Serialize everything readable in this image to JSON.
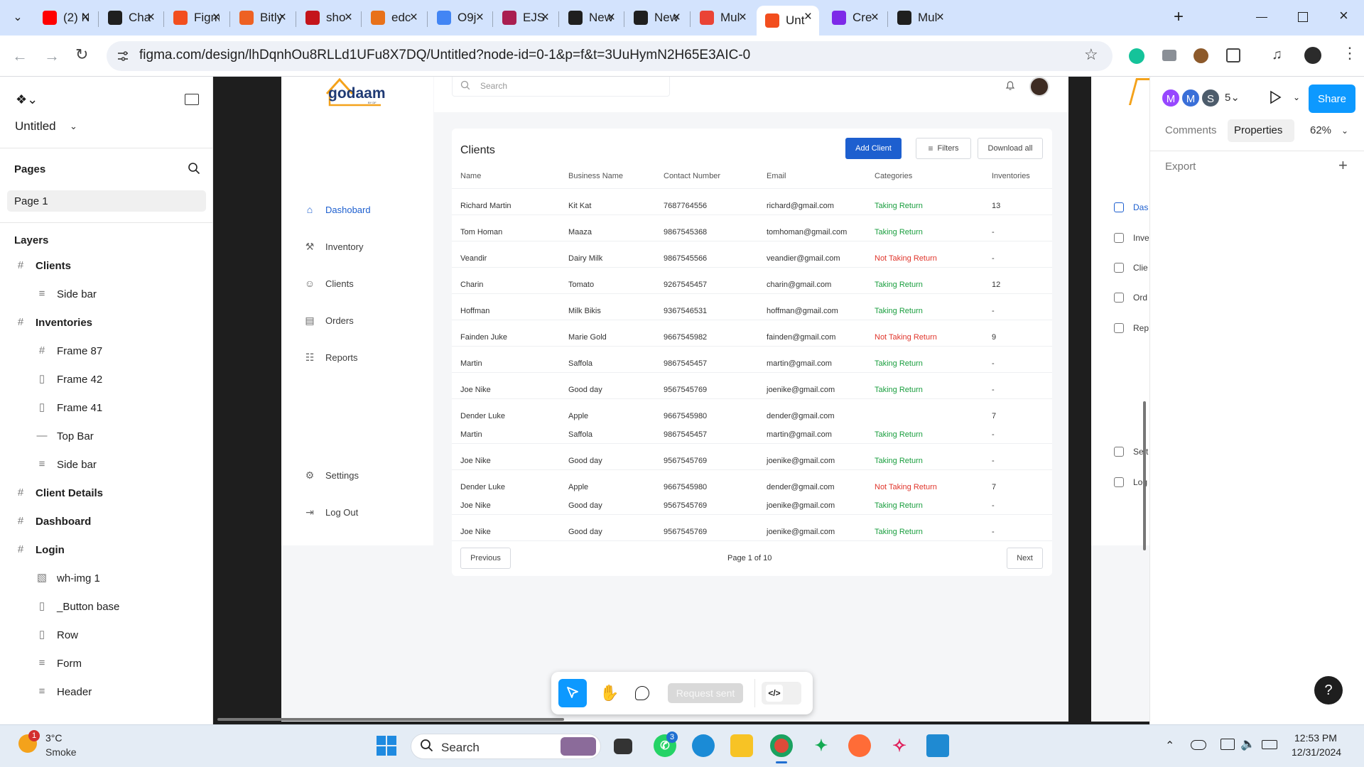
{
  "browser": {
    "tabs": [
      {
        "title": "(2) N",
        "icon": "youtube-icon",
        "color": "#ff0000"
      },
      {
        "title": "Cha",
        "icon": "chatgpt-icon",
        "color": "#1f1f1f"
      },
      {
        "title": "Figm",
        "icon": "figma-icon",
        "color": "#f24e1e"
      },
      {
        "title": "Bitly",
        "icon": "bitly-icon",
        "color": "#ee6123"
      },
      {
        "title": "sho",
        "icon": "netflix-icon",
        "color": "#c4141b"
      },
      {
        "title": "edc",
        "icon": "edc-icon",
        "color": "#e8711a"
      },
      {
        "title": "O9j",
        "icon": "google-icon",
        "color": "#4285f4"
      },
      {
        "title": "EJS",
        "icon": "ejs-icon",
        "color": "#a91e50"
      },
      {
        "title": "New",
        "icon": "chatgpt-icon",
        "color": "#1f1f1f"
      },
      {
        "title": "New",
        "icon": "chatgpt-icon",
        "color": "#1f1f1f"
      },
      {
        "title": "Mul",
        "icon": "gmail-icon",
        "color": "#ea4335"
      },
      {
        "title": "Unt",
        "icon": "figma-icon",
        "color": "#f24e1e",
        "active": true
      },
      {
        "title": "Cre",
        "icon": "canva-icon",
        "color": "#7d2ae8"
      },
      {
        "title": "Mul",
        "icon": "github-icon",
        "color": "#1f1f1f"
      }
    ],
    "url": "figma.com/design/lhDqnhOu8RLLd1UFu8X7DQ/Untitled?node-id=0-1&p=f&t=3UuHymN2H65E3AIC-0"
  },
  "figma": {
    "file_name": "Untitled",
    "pages_label": "Pages",
    "current_page": "Page 1",
    "layers_label": "Layers",
    "layers": [
      {
        "name": "Clients",
        "level": 0,
        "icon": "frame-icon"
      },
      {
        "name": "Side bar",
        "level": 1,
        "icon": "auto-layout-icon"
      },
      {
        "name": "Inventories",
        "level": 0,
        "icon": "frame-icon"
      },
      {
        "name": "Frame 87",
        "level": 1,
        "icon": "frame-icon"
      },
      {
        "name": "Frame 42",
        "level": 1,
        "icon": "component-icon"
      },
      {
        "name": "Frame 41",
        "level": 1,
        "icon": "component-icon"
      },
      {
        "name": "Top Bar",
        "level": 1,
        "icon": "line-icon"
      },
      {
        "name": "Side bar",
        "level": 1,
        "icon": "auto-layout-icon"
      },
      {
        "name": "Client Details",
        "level": 0,
        "icon": "frame-icon"
      },
      {
        "name": "Dashboard",
        "level": 0,
        "icon": "frame-icon"
      },
      {
        "name": "Login",
        "level": 0,
        "icon": "frame-icon"
      },
      {
        "name": "wh-img 1",
        "level": 1,
        "icon": "image-icon"
      },
      {
        "name": "_Button base",
        "level": 1,
        "icon": "component-icon"
      },
      {
        "name": "Row",
        "level": 1,
        "icon": "component-icon"
      },
      {
        "name": "Form",
        "level": 1,
        "icon": "auto-layout-icon"
      },
      {
        "name": "Header",
        "level": 1,
        "icon": "auto-layout-icon"
      }
    ],
    "right_panel": {
      "avatars": [
        "M",
        "M",
        "S"
      ],
      "avatar_count": "5",
      "share_label": "Share",
      "tabs": [
        "Comments",
        "Properties"
      ],
      "zoom": "62%",
      "export_label": "Export"
    },
    "toolbar": {
      "request_label": "Request sent"
    }
  },
  "app": {
    "logo_text": "godaam",
    "logo_sub": "BY DF",
    "search_placeholder": "Search",
    "nav": [
      {
        "label": "Dashobard",
        "icon": "home-icon",
        "active": true
      },
      {
        "label": "Inventory",
        "icon": "inventory-icon"
      },
      {
        "label": "Clients",
        "icon": "user-circle-icon"
      },
      {
        "label": "Orders",
        "icon": "orders-icon"
      },
      {
        "label": "Reports",
        "icon": "reports-icon"
      }
    ],
    "nav_bottom": [
      {
        "label": "Settings",
        "icon": "settings-icon"
      },
      {
        "label": "Log Out",
        "icon": "logout-icon"
      }
    ],
    "right_frame_nav": [
      "Das",
      "Inve",
      "Clie",
      "Ord",
      "Rep",
      "Sett",
      "Log"
    ],
    "card": {
      "title": "Clients",
      "add_button": "Add Client",
      "filters_button": "Filters",
      "download_button": "Download all",
      "columns": [
        "Name",
        "Business Name",
        "Contact Number",
        "Email",
        "Categories",
        "Inventories"
      ],
      "rows": [
        [
          "Richard Martin",
          "Kit Kat",
          "7687764556",
          "richard@gmail.com",
          "Taking Return",
          "13"
        ],
        [
          "Tom Homan",
          "Maaza",
          "9867545368",
          "tomhoman@gmail.com",
          "Taking Return",
          "-"
        ],
        [
          "Veandir",
          "Dairy Milk",
          "9867545566",
          "veandier@gmail.com",
          "Not Taking Return",
          "-"
        ],
        [
          "Charin",
          "Tomato",
          "9267545457",
          "charin@gmail.com",
          "Taking Return",
          "12"
        ],
        [
          "Hoffman",
          "Milk Bikis",
          "9367546531",
          "hoffman@gmail.com",
          "Taking Return",
          "-"
        ],
        [
          "Fainden Juke",
          "Marie Gold",
          "9667545982",
          "fainden@gmail.com",
          "Not Taking Return",
          "9"
        ],
        [
          "Martin",
          "Saffola",
          "9867545457",
          "martin@gmail.com",
          "Taking Return",
          "-"
        ],
        [
          "Joe Nike",
          "Good day",
          "9567545769",
          "joenike@gmail.com",
          "Taking Return",
          "-"
        ],
        [
          "Dender Luke",
          "Apple",
          "9667545980",
          "dender@gmail.com",
          "",
          "7"
        ],
        [
          "Martin",
          "Saffola",
          "9867545457",
          "martin@gmail.com",
          "Taking Return",
          "-"
        ],
        [
          "Joe Nike",
          "Good day",
          "9567545769",
          "joenike@gmail.com",
          "Taking Return",
          "-"
        ],
        [
          "Dender Luke",
          "Apple",
          "9667545980",
          "dender@gmail.com",
          "Not Taking Return",
          "7"
        ],
        [
          "Joe Nike",
          "Good day",
          "9567545769",
          "joenike@gmail.com",
          "Taking Return",
          "-"
        ],
        [
          "Joe Nike",
          "Good day",
          "9567545769",
          "joenike@gmail.com",
          "Taking Return",
          "-"
        ]
      ],
      "prev_label": "Previous",
      "page_label": "Page 1 of 10",
      "next_label": "Next"
    },
    "colors": {
      "taking": "#1a9e3f",
      "not_taking": "#e0352b",
      "primary": "#1d5fcf"
    }
  },
  "taskbar": {
    "weather_temp": "3°C",
    "weather_desc": "Smoke",
    "weather_badge": "1",
    "search_label": "Search",
    "whatsapp_badge": "3",
    "time": "12:53 PM",
    "date": "12/31/2024"
  }
}
